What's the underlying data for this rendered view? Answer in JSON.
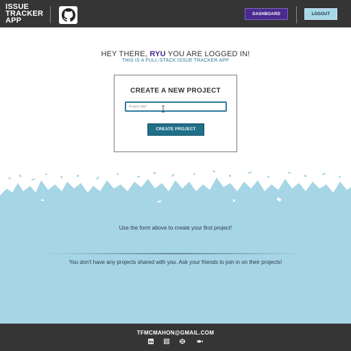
{
  "header": {
    "logo_lines": [
      "ISSUE",
      "TRACKER",
      "APP"
    ],
    "github_icon": "github-icon",
    "dashboard_label": "DASHBOARD",
    "logout_label": "LOGOUT"
  },
  "greeting": {
    "prefix": "HEY THERE, ",
    "username": "RYU",
    "suffix": " YOU ARE LOGGED IN!",
    "subtitle": "THIS IS A FULL-STACK ISSUE TRACKER APP"
  },
  "create_project": {
    "title": "CREATE A NEW PROJECT",
    "input_placeholder": "Project title*",
    "input_value": "",
    "button_label": "CREATE PROJECT"
  },
  "projects": {
    "empty_message": "Use the form above to create your first project!",
    "shared_empty_message": "You don't have any projects shared with you. Ask your friends to join in on their projects!"
  },
  "footer": {
    "email": "TFMCMAHON@GMAIL.COM",
    "social_icons": [
      "linkedin-icon",
      "instagram-icon",
      "codepen-icon",
      "fish-icon"
    ]
  },
  "colors": {
    "header_bg": "#353535",
    "accent_purple": "#4a2a8f",
    "accent_teal": "#1f7088",
    "light_blue": "#a6d5e6"
  }
}
